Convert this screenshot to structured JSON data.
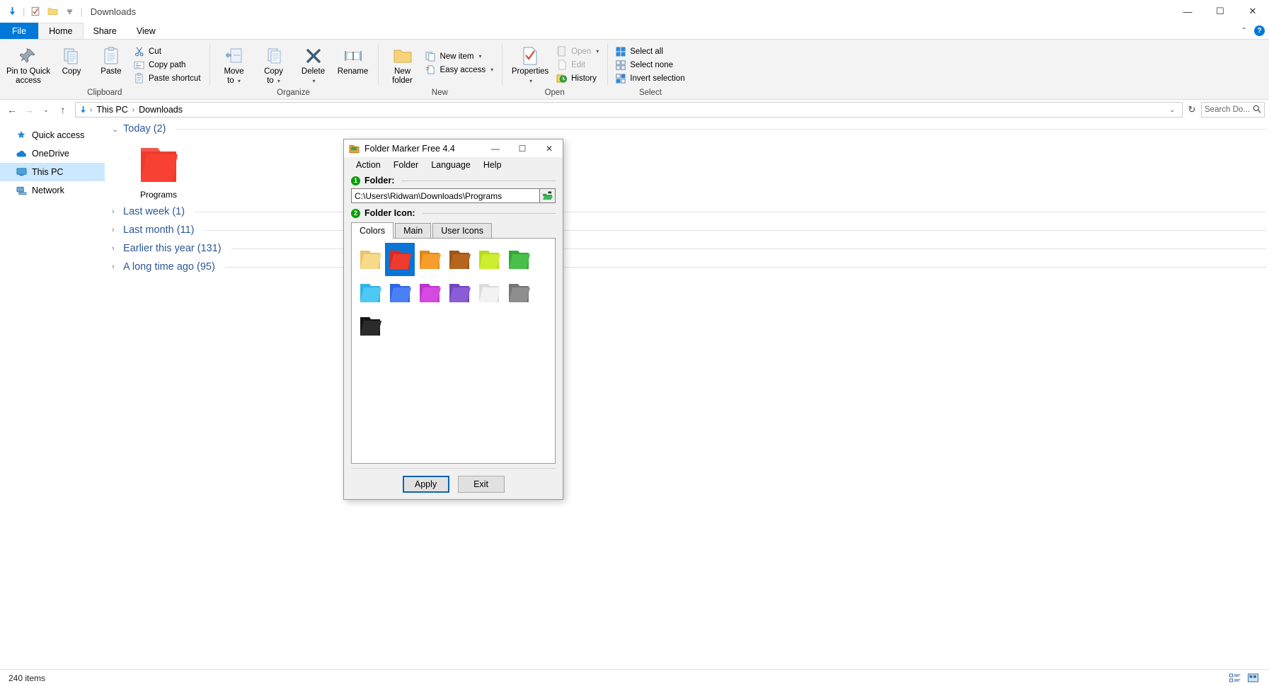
{
  "explorer": {
    "window_title": "Downloads",
    "quick_access_icons": [
      "download-arrow-icon",
      "properties-check-icon",
      "new-folder-icon",
      "customize-caret-icon"
    ],
    "window_controls": {
      "minimize": "—",
      "maximize": "☐",
      "close": "✕"
    },
    "ribbon": {
      "tabs": [
        {
          "label": "File",
          "active": false,
          "is_file": true
        },
        {
          "label": "Home",
          "active": true,
          "is_file": false
        },
        {
          "label": "Share",
          "active": false,
          "is_file": false
        },
        {
          "label": "View",
          "active": false,
          "is_file": false
        }
      ],
      "help_label": "?",
      "collapse_caret": "⌃",
      "groups": [
        {
          "label": "Clipboard",
          "big_buttons": [
            {
              "label": "Pin to Quick\naccess",
              "line1": "Pin to Quick",
              "line2": "access",
              "icon": "pin-icon"
            },
            {
              "label": "Copy",
              "line1": "Copy",
              "line2": "",
              "icon": "copy-icon"
            },
            {
              "label": "Paste",
              "line1": "Paste",
              "line2": "",
              "icon": "paste-icon"
            }
          ],
          "small_buttons": [
            {
              "label": "Cut",
              "icon": "scissors-icon",
              "disabled": false
            },
            {
              "label": "Copy path",
              "icon": "copy-path-icon",
              "disabled": false
            },
            {
              "label": "Paste shortcut",
              "icon": "paste-shortcut-icon",
              "disabled": false
            }
          ]
        },
        {
          "label": "Organize",
          "big_buttons": [
            {
              "line1": "Move",
              "line2": "to",
              "icon": "move-to-icon",
              "has_dropdown": true
            },
            {
              "line1": "Copy",
              "line2": "to",
              "icon": "copy-to-icon",
              "has_dropdown": true
            },
            {
              "line1": "Delete",
              "line2": "",
              "icon": "delete-x-icon",
              "has_dropdown": true
            },
            {
              "line1": "Rename",
              "line2": "",
              "icon": "rename-icon",
              "has_dropdown": false
            }
          ],
          "small_buttons": []
        },
        {
          "label": "New",
          "big_buttons": [
            {
              "line1": "New",
              "line2": "folder",
              "icon": "new-folder-icon",
              "has_dropdown": false
            }
          ],
          "small_buttons": [
            {
              "label": "New item",
              "icon": "new-item-icon",
              "has_dropdown": true,
              "disabled": false
            },
            {
              "label": "Easy access",
              "icon": "easy-access-icon",
              "has_dropdown": true,
              "disabled": false
            }
          ]
        },
        {
          "label": "Open",
          "big_buttons": [
            {
              "line1": "Properties",
              "line2": "",
              "icon": "properties-icon",
              "has_dropdown": true
            }
          ],
          "small_buttons": [
            {
              "label": "Open",
              "icon": "open-icon",
              "has_dropdown": true,
              "disabled": true
            },
            {
              "label": "Edit",
              "icon": "edit-icon",
              "has_dropdown": false,
              "disabled": true
            },
            {
              "label": "History",
              "icon": "history-icon",
              "has_dropdown": false,
              "disabled": false
            }
          ]
        },
        {
          "label": "Select",
          "big_buttons": [],
          "small_buttons": [
            {
              "label": "Select all",
              "icon": "select-all-icon",
              "disabled": false
            },
            {
              "label": "Select none",
              "icon": "select-none-icon",
              "disabled": false
            },
            {
              "label": "Invert selection",
              "icon": "invert-selection-icon",
              "disabled": false
            }
          ]
        }
      ]
    },
    "address": {
      "back_icon": "back-arrow-icon",
      "forward_icon": "forward-arrow-icon",
      "recent_icon": "recent-locations-caret",
      "up_icon": "up-arrow-icon",
      "crumb_icon": "downloads-arrow-icon",
      "crumbs": [
        "This PC",
        "Downloads"
      ],
      "separator": "›",
      "dropdown_caret": "⌄",
      "refresh_icon": "refresh-icon",
      "search_placeholder": "Search Do...",
      "search_icon": "search-icon"
    },
    "sidebar": {
      "items": [
        {
          "label": "Quick access",
          "icon": "star-pin-icon",
          "selected": false
        },
        {
          "label": "OneDrive",
          "icon": "cloud-icon",
          "selected": false
        },
        {
          "label": "This PC",
          "icon": "monitor-icon",
          "selected": true
        },
        {
          "label": "Network",
          "icon": "network-icon",
          "selected": false
        }
      ]
    },
    "content": {
      "groups": [
        {
          "label": "Today (2)",
          "expanded": true,
          "chevron": "⌄",
          "items": [
            {
              "name": "Programs",
              "icon": "folder-red-icon"
            }
          ]
        },
        {
          "label": "Last week (1)",
          "expanded": false,
          "chevron": "›",
          "items": []
        },
        {
          "label": "Last month (11)",
          "expanded": false,
          "chevron": "›",
          "items": []
        },
        {
          "label": "Earlier this year (131)",
          "expanded": false,
          "chevron": "›",
          "items": []
        },
        {
          "label": "A long time ago (95)",
          "expanded": false,
          "chevron": "›",
          "items": []
        }
      ]
    },
    "statusbar": {
      "item_count": "240 items",
      "details_view_icon": "details-view-icon",
      "large_icons_view_icon": "large-icons-view-icon"
    }
  },
  "dialog": {
    "title": "Folder Marker Free 4.4",
    "app_icon": "folder-marker-icon",
    "window_controls": {
      "minimize": "—",
      "maximize": "☐",
      "close": "✕"
    },
    "menu": [
      "Action",
      "Folder",
      "Language",
      "Help"
    ],
    "section1": {
      "number": "1",
      "label": "Folder:"
    },
    "path_value": "C:\\Users\\Ridwan\\Downloads\\Programs",
    "browse_icon": "open-folder-browse-icon",
    "section2": {
      "number": "2",
      "label": "Folder Icon:"
    },
    "tabs": [
      {
        "label": "Colors",
        "active": true
      },
      {
        "label": "Main",
        "active": false
      },
      {
        "label": "User Icons",
        "active": false
      }
    ],
    "icons": [
      {
        "name": "folder-yellow",
        "color": "#f7d98a",
        "dark": "#e9c46a",
        "selected": false
      },
      {
        "name": "folder-red",
        "color": "#ef3b2d",
        "dark": "#d92a1c",
        "selected": true
      },
      {
        "name": "folder-orange",
        "color": "#f79d2e",
        "dark": "#e2881a",
        "selected": false
      },
      {
        "name": "folder-brown",
        "color": "#b5651d",
        "dark": "#9c5516",
        "selected": false
      },
      {
        "name": "folder-lime",
        "color": "#ccee2e",
        "dark": "#b8d922",
        "selected": false
      },
      {
        "name": "folder-green",
        "color": "#49c04b",
        "dark": "#34a836",
        "selected": false
      },
      {
        "name": "folder-cyan",
        "color": "#4ec7f2",
        "dark": "#2eb3e6",
        "selected": false
      },
      {
        "name": "folder-blue",
        "color": "#4a80f5",
        "dark": "#2f66e0",
        "selected": false
      },
      {
        "name": "folder-magenta",
        "color": "#d44ae0",
        "dark": "#bf32cc",
        "selected": false
      },
      {
        "name": "folder-purple",
        "color": "#8a5cd6",
        "dark": "#7344c4",
        "selected": false
      },
      {
        "name": "folder-white",
        "color": "#f2f2f2",
        "dark": "#dcdcdc",
        "selected": false
      },
      {
        "name": "folder-gray",
        "color": "#8e8e8e",
        "dark": "#757575",
        "selected": false
      },
      {
        "name": "folder-black",
        "color": "#2b2b2b",
        "dark": "#151515",
        "selected": false
      }
    ],
    "buttons": [
      {
        "label": "Apply",
        "default": true
      },
      {
        "label": "Exit",
        "default": false
      }
    ]
  },
  "colors": {
    "accent_blue": "#0078d7",
    "selection_blue": "#0a74d7",
    "group_header_blue": "#2b5797",
    "sidebar_selected": "#cce8ff",
    "ribbon_bg": "#f3f3f3",
    "dialog_bg": "#f0f0f0",
    "green_badge": "#00a000"
  }
}
